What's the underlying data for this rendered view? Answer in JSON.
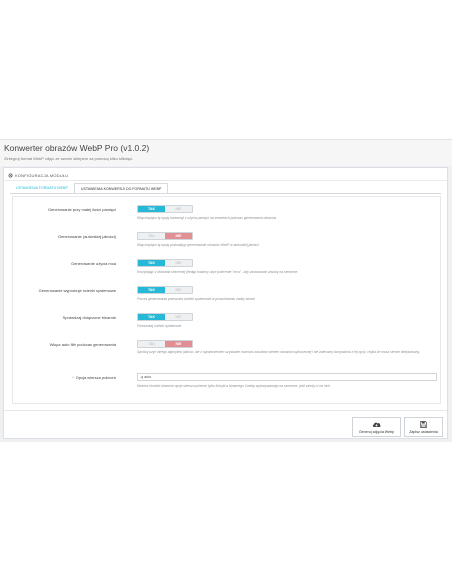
{
  "page": {
    "title": "Konwerter obrazów WebP Pro (v1.0.2)",
    "subtitle": "Zintegruj format WebP zdjęć ze swoim sklepem za pomocą kilku kliknięć."
  },
  "panel": {
    "heading": "KONFIGURACJA MODUŁU",
    "heading_icon": "gear-icon"
  },
  "tabs": [
    {
      "label": "USTAWIENIA FORMATU WEBP",
      "active": false
    },
    {
      "label": "USTAWIENIA KONWERSJI DO FORMATU WEBP",
      "active": true
    }
  ],
  "switch_labels": {
    "yes": "TAK",
    "no": "NIE"
  },
  "rows": [
    {
      "label": "Generowanie przy małej ilości pamięci",
      "value": "TAK",
      "help": "Włącz/wyłącz tę opcję konwersji z użycia pamięci na serwerach podczas generowania obrazów"
    },
    {
      "label": "Generowanie (autorskiej jakości)",
      "value": "NIE",
      "help": "Włącz/wyłącz tę opcję pozwalając generowanie obrazów WebP w autorskiej jakości."
    },
    {
      "label": "Generowanie użycia mca",
      "value": "TAK",
      "help": "Korzystając z dobrania sekcemej (tiedęp tostamy użyć polecenie \"mca\" , aby zastosować zasoby na serwerze."
    },
    {
      "label": "Generowanie wyprobuje ścieżki systemowe",
      "value": "TAK",
      "help": "Proces generowania przeszuka ścieżki systemowe w poszukiwaniu zadky binarii."
    },
    {
      "label": "Sprawdzaj dołączone binarnie",
      "value": "TAK",
      "help": "Przeszukaj ścieżki systemowe"
    },
    {
      "label": "Włącz auto filtr podczas generowania",
      "value": "NIE",
      "help": "Spróbuj użyć innego algorytmu jakości, ale z ograniczeniem uzyskanie rozmiaru zasobów wenem obrazów wykluczonej i nie zalecamy korzystania z tej opcji, chyba że masz serwer dedykowany."
    }
  ],
  "text_field": {
    "label": "Opcja wiersza poleceń",
    "value": "-q auto",
    "help": "Możesz określić dowolne opcje wiersza poleceń tylko którykt-a binarnego Cwebp wykonywanego na serwerze, jeśli zależy ci na nich."
  },
  "buttons": {
    "generate": {
      "label": "Generuj zdjęcia Webp",
      "icon": "cloud-download-icon"
    },
    "save": {
      "label": "Zapisz ustawienia",
      "icon": "floppy-disk-icon"
    }
  },
  "colors": {
    "accent": "#25b9d7",
    "danger": "#e08f95"
  }
}
